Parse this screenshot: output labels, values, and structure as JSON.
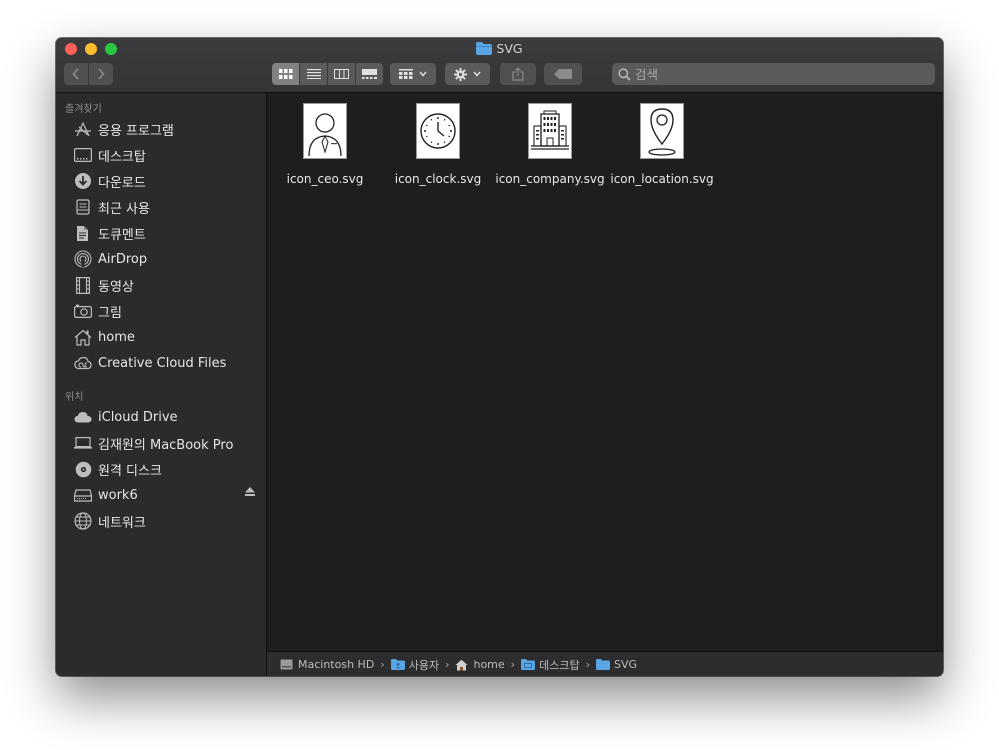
{
  "window": {
    "title": "SVG"
  },
  "toolbar": {
    "back_icon": "chevron-left-icon",
    "forward_icon": "chevron-right-icon",
    "views": [
      "icon-view",
      "list-view",
      "column-view",
      "gallery-view"
    ],
    "active_view": "icon-view",
    "search_placeholder": "검색"
  },
  "sidebar": {
    "favorites_header": "즐겨찾기",
    "favorites": [
      {
        "label": "응용 프로그램",
        "icon": "applications-icon"
      },
      {
        "label": "데스크탑",
        "icon": "desktop-icon"
      },
      {
        "label": "다운로드",
        "icon": "downloads-icon"
      },
      {
        "label": "최근 사용",
        "icon": "recents-icon"
      },
      {
        "label": "도큐멘트",
        "icon": "documents-icon"
      },
      {
        "label": "AirDrop",
        "icon": "airdrop-icon"
      },
      {
        "label": "동영상",
        "icon": "movies-icon"
      },
      {
        "label": "그림",
        "icon": "pictures-icon"
      },
      {
        "label": "home",
        "icon": "home-icon"
      },
      {
        "label": "Creative Cloud Files",
        "icon": "creative-cloud-icon"
      }
    ],
    "locations_header": "위치",
    "locations": [
      {
        "label": "iCloud Drive",
        "icon": "cloud-icon"
      },
      {
        "label": "김재원의 MacBook Pro",
        "icon": "laptop-icon"
      },
      {
        "label": "원격 디스크",
        "icon": "disc-icon"
      },
      {
        "label": "work6",
        "icon": "drive-icon",
        "ejectable": true
      },
      {
        "label": "네트워크",
        "icon": "network-icon"
      }
    ]
  },
  "files": [
    {
      "name": "icon_ceo.svg",
      "icon": "person-icon"
    },
    {
      "name": "icon_clock.svg",
      "icon": "clock-icon"
    },
    {
      "name": "icon_company.svg",
      "icon": "building-icon"
    },
    {
      "name": "icon_location.svg",
      "icon": "location-pin-icon"
    }
  ],
  "pathbar": {
    "items": [
      "Macintosh HD",
      "사용자",
      "home",
      "데스크탑",
      "SVG"
    ]
  },
  "colors": {
    "folder_blue": "#5aa6e4",
    "close": "#fe5f57",
    "minimize": "#febc2e",
    "zoom": "#28c840"
  }
}
